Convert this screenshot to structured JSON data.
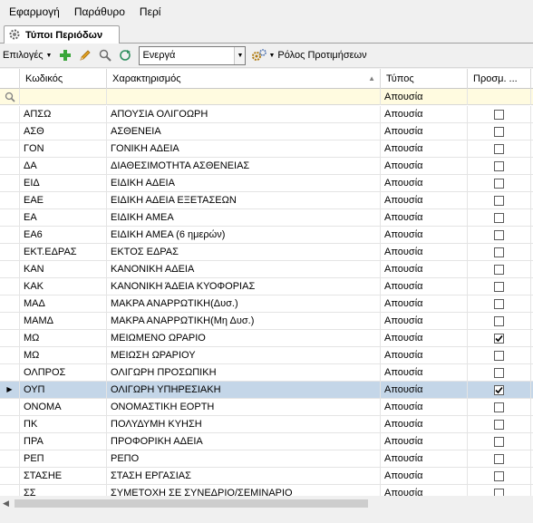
{
  "menu": [
    "Εφαρμογή",
    "Παράθυρο",
    "Περί"
  ],
  "tab": {
    "title": "Τύποι Περιόδων"
  },
  "toolbar": {
    "options_label": "Επιλογές",
    "filter_value": "Ενεργά",
    "roles_label": "Ρόλος Προτιμήσεων"
  },
  "columns": {
    "code": "Κωδικός",
    "description": "Χαρακτηρισμός",
    "type": "Τύπος",
    "extra": "Προσμ. ..."
  },
  "filter_row": {
    "type": "Απουσία"
  },
  "rows": [
    {
      "code": "ΑΠΣΩ",
      "description": "ΑΠΟΥΣΙΑ ΟΛΙΓΟΩΡΗ",
      "type": "Απουσία",
      "checked": false,
      "selected": false
    },
    {
      "code": "ΑΣΘ",
      "description": "ΑΣΘΕΝΕΙΑ",
      "type": "Απουσία",
      "checked": false,
      "selected": false
    },
    {
      "code": "ΓΟΝ",
      "description": "ΓΟΝΙΚΗ ΑΔΕΙΑ",
      "type": "Απουσία",
      "checked": false,
      "selected": false
    },
    {
      "code": "ΔΑ",
      "description": "ΔΙΑΘΕΣΙΜΟΤΗΤΑ ΑΣΘΕΝΕΙΑΣ",
      "type": "Απουσία",
      "checked": false,
      "selected": false
    },
    {
      "code": "ΕΙΔ",
      "description": "ΕΙΔΙΚΗ ΑΔΕΙΑ",
      "type": "Απουσία",
      "checked": false,
      "selected": false
    },
    {
      "code": "ΕΑΕ",
      "description": "ΕΙΔΙΚΗ ΑΔΕΙΑ ΕΞΕΤΑΣΕΩΝ",
      "type": "Απουσία",
      "checked": false,
      "selected": false
    },
    {
      "code": "ΕΑ",
      "description": "ΕΙΔΙΚΗ ΑΜΕΑ",
      "type": "Απουσία",
      "checked": false,
      "selected": false
    },
    {
      "code": "ΕΑ6",
      "description": "ΕΙΔΙΚΗ ΑΜΕΑ (6 ημερών)",
      "type": "Απουσία",
      "checked": false,
      "selected": false
    },
    {
      "code": "ΕΚΤ.ΕΔΡΑΣ",
      "description": "ΕΚΤΟΣ ΕΔΡΑΣ",
      "type": "Απουσία",
      "checked": false,
      "selected": false
    },
    {
      "code": "ΚΑΝ",
      "description": "ΚΑΝΟΝΙΚΗ ΑΔΕΙΑ",
      "type": "Απουσία",
      "checked": false,
      "selected": false
    },
    {
      "code": "ΚΑΚ",
      "description": "ΚΑΝΟΝΙΚΗ ΆΔΕΙΑ ΚΥΟΦΟΡΙΑΣ",
      "type": "Απουσία",
      "checked": false,
      "selected": false
    },
    {
      "code": "ΜΑΔ",
      "description": "ΜΑΚΡΑ ΑΝΑΡΡΩΤΙΚΗ(Δυσ.)",
      "type": "Απουσία",
      "checked": false,
      "selected": false
    },
    {
      "code": "ΜΑΜΔ",
      "description": "ΜΑΚΡΑ ΑΝΑΡΡΩΤΙΚΗ(Μη Δυσ.)",
      "type": "Απουσία",
      "checked": false,
      "selected": false
    },
    {
      "code": "ΜΩ",
      "description": "ΜΕΙΩΜΕΝΟ ΩΡΑΡΙΟ",
      "type": "Απουσία",
      "checked": true,
      "selected": false
    },
    {
      "code": "ΜΩ",
      "description": "ΜΕΙΩΣΗ ΩΡΑΡΙΟΥ",
      "type": "Απουσία",
      "checked": false,
      "selected": false
    },
    {
      "code": "ΟΛΠΡΟΣ",
      "description": "ΟΛΙΓΩΡΗ ΠΡΟΣΩΠΙΚΗ",
      "type": "Απουσία",
      "checked": false,
      "selected": false
    },
    {
      "code": "ΟΥΠ",
      "description": "ΟΛΙΓΩΡΗ ΥΠΗΡΕΣΙΑΚΗ",
      "type": "Απουσία",
      "checked": true,
      "selected": true
    },
    {
      "code": "ΟΝΟΜΑ",
      "description": "ΟΝΟΜΑΣΤΙΚΗ ΕΟΡΤΗ",
      "type": "Απουσία",
      "checked": false,
      "selected": false
    },
    {
      "code": "ΠΚ",
      "description": "ΠΟΛΥΔΥΜΗ ΚΥΗΣΗ",
      "type": "Απουσία",
      "checked": false,
      "selected": false
    },
    {
      "code": "ΠΡΑ",
      "description": "ΠΡΟΦΟΡΙΚΗ ΑΔΕΙΑ",
      "type": "Απουσία",
      "checked": false,
      "selected": false
    },
    {
      "code": "ΡΕΠ",
      "description": "ΡΕΠΟ",
      "type": "Απουσία",
      "checked": false,
      "selected": false
    },
    {
      "code": "ΣΤΑΣΗΕ",
      "description": "ΣΤΑΣΗ ΕΡΓΑΣΙΑΣ",
      "type": "Απουσία",
      "checked": false,
      "selected": false
    },
    {
      "code": "ΣΣ",
      "description": "ΣΥΜΕΤΟΧΗ ΣΕ ΣΥΝΕΔΡΙΟ/ΣΕΜΙΝΑΡΙΟ",
      "type": "Απουσία",
      "checked": false,
      "selected": false
    }
  ],
  "icons": {
    "add": "plus-icon",
    "edit": "pencil-icon",
    "search": "magnifier-icon",
    "refresh": "refresh-icon",
    "roles": "gears-icon",
    "filter_search": "search-icon",
    "selected_row": "row-pointer-icon"
  },
  "colors": {
    "selected_row": "#c4d6e8",
    "filter_row": "#fffbe0",
    "add_icon": "#3aa63a"
  }
}
